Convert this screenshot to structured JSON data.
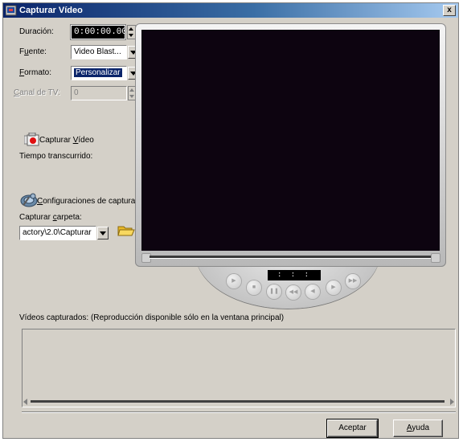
{
  "window": {
    "title": "Capturar Vídeo",
    "close_label": "x"
  },
  "settings": {
    "duration_label": "Duración:",
    "duration_value": "0:00:00.00",
    "source_label_pre": "F",
    "source_label_ul": "u",
    "source_label_post": "ente:",
    "source_value": "Video Blast...",
    "format_label_pre": "",
    "format_label_ul": "F",
    "format_label_post": "ormato:",
    "format_value": "Personalizar",
    "tv_channel_label_pre": "",
    "tv_channel_label_ul": "C",
    "tv_channel_label_post": "anal de TV:",
    "tv_channel_value": "0"
  },
  "capture": {
    "label_pre": "Capturar ",
    "label_ul": "V",
    "label_post": "ídeo",
    "elapsed_label": "Tiempo transcurrido:"
  },
  "config": {
    "settings_label_pre": "",
    "settings_label_ul": "C",
    "settings_label_post": "onfiguraciones de captura...",
    "folder_label_pre": "Capturar ",
    "folder_label_ul": "c",
    "folder_label_post": "arpeta:",
    "folder_value": "actory\\2.0\\Capturar"
  },
  "player": {
    "time_display": ": : :"
  },
  "captured": {
    "label": "Vídeos capturados: (Reproducción disponible sólo en la ventana principal)"
  },
  "buttons": {
    "accept_label": "Aceptar",
    "help_label_ul": "A",
    "help_label_post": "yuda"
  }
}
